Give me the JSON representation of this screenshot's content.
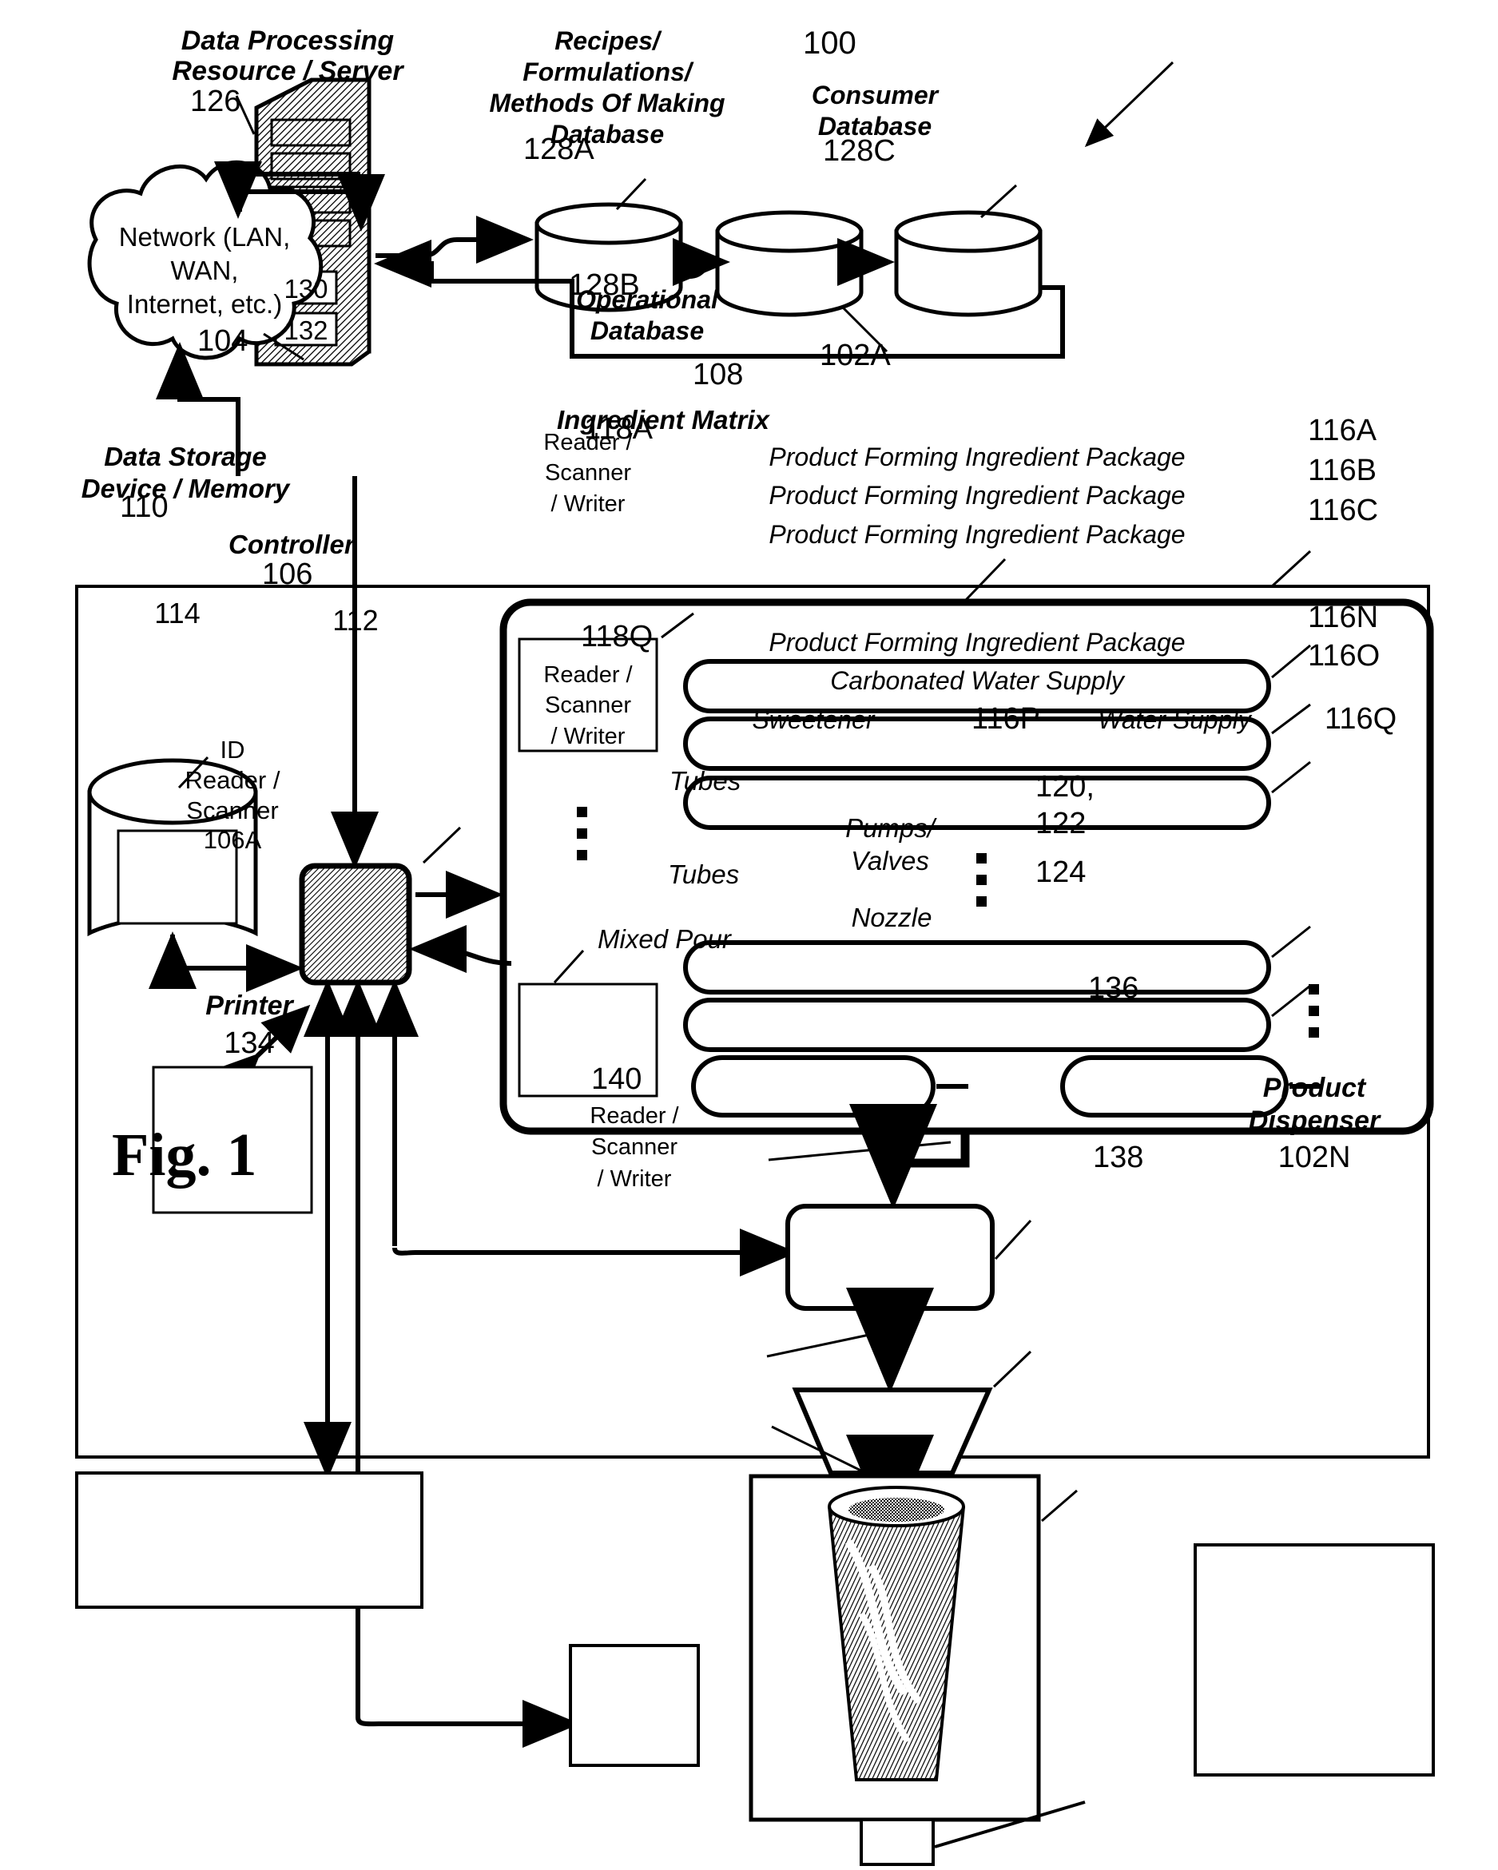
{
  "figure": {
    "caption": "Fig. 1",
    "system_ref": "100"
  },
  "server": {
    "title_line1": "Data Processing",
    "title_line2": "Resource / Server",
    "ref": "126",
    "slot_top": "130",
    "slot_bottom": "132"
  },
  "network": {
    "line1": "Network (LAN,",
    "line2": "WAN,",
    "line3": "Internet, etc.)",
    "ref": "104"
  },
  "databases": [
    {
      "title_lines": [
        "Recipes/",
        "Formulations/",
        "Methods Of Making",
        "Database"
      ],
      "ref": "128A"
    },
    {
      "title_lines": [
        "Operational",
        "Database"
      ],
      "ref": "128B"
    },
    {
      "title_lines": [
        "Consumer",
        "Database"
      ],
      "ref": "128C"
    }
  ],
  "dispenser": {
    "ref": "102A",
    "storage": {
      "title_line1": "Data Storage",
      "title_line2": "Device / Memory",
      "ref": "110",
      "inner_ref": "114"
    },
    "controller": {
      "label": "Controller",
      "ref": "106",
      "inner_ref": "112"
    },
    "id_reader": {
      "line1": "ID",
      "line2": "Reader /",
      "line3": "Scanner",
      "ref": "106A"
    },
    "matrix": {
      "title": "Ingredient Matrix",
      "ref": "108",
      "readers": [
        {
          "line1": "Reader /",
          "line2": "Scanner",
          "line3": "/ Writer",
          "ref": "118A"
        },
        {
          "line1": "Reader /",
          "line2": "Scanner",
          "line3": "/ Writer",
          "ref": "118Q"
        }
      ],
      "packages": [
        {
          "label": "Product Forming Ingredient Package",
          "ref": "116A"
        },
        {
          "label": "Product Forming Ingredient Package",
          "ref": "116B"
        },
        {
          "label": "Product Forming Ingredient Package",
          "ref": "116C"
        },
        {
          "label": "Product Forming Ingredient Package",
          "ref": "116N"
        },
        {
          "label": "Carbonated Water Supply",
          "ref": "116O"
        },
        {
          "label": "Sweetener",
          "ref": "116P"
        },
        {
          "label": "Water Supply",
          "ref": "116Q"
        }
      ]
    },
    "tubes_upper_label": "Tubes",
    "pumps": {
      "line1": "Pumps/",
      "line2": "Valves",
      "ref_line1": "120,",
      "ref_line2": "122"
    },
    "tubes_lower_label": "Tubes",
    "nozzle": {
      "label": "Nozzle",
      "ref": "124"
    },
    "mixed_pour_label": "Mixed Pour"
  },
  "printer": {
    "label": "Printer",
    "ref": "134"
  },
  "cup_station": {
    "cup_ref": "136",
    "base_ref": "138",
    "reader": {
      "line1": "Reader /",
      "line2": "Scanner",
      "line3": "/ Writer",
      "ref": "140"
    }
  },
  "product_dispenser_n": {
    "line1": "Product",
    "line2": "Dispenser",
    "ref": "102N"
  },
  "colors": {
    "ink": "#000000",
    "paper": "#ffffff"
  }
}
